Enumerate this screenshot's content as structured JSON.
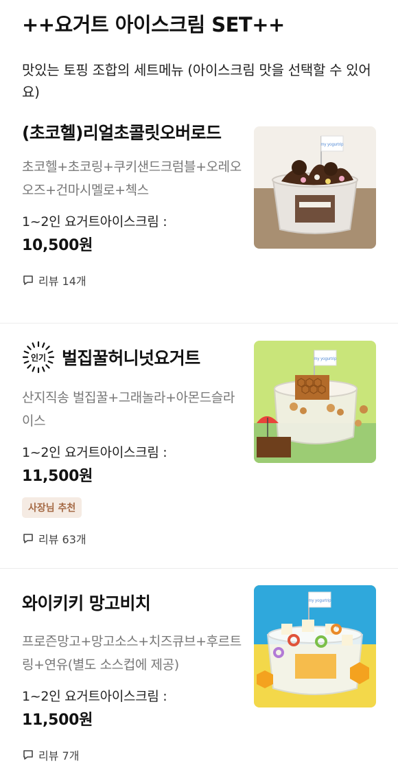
{
  "section": {
    "title": "++요거트 아이스크림 SET++",
    "description": "맛있는 토핑 조합의 세트메뉴 (아이스크림 맛을 선택할 수 있어요)"
  },
  "items": [
    {
      "name": "(초코헬)리얼초콜릿오버로드",
      "description": "초코헬+초코링+쿠키샌드크럼블+오레오오즈+건마시멜로+첵스",
      "serving": "1~2인 요거트아이스크림 :",
      "price": "10,500원",
      "review": "리뷰 14개",
      "image_icon": "chocolate-yogurt-photo"
    },
    {
      "name": "벌집꿀허니넛요거트",
      "popular_label": "인기",
      "description": "산지직송 벌집꿀+그래놀라+아몬드슬라이스",
      "serving": "1~2인 요거트아이스크림 :",
      "price": "11,500원",
      "badge": "사장님 추천",
      "review": "리뷰 63개",
      "image_icon": "honeycomb-yogurt-photo"
    },
    {
      "name": "와이키키 망고비치",
      "description": "프로즌망고+망고소스+치즈큐브+후르트링+연유(별도 소스컵에 제공)",
      "serving": "1~2인 요거트아이스크림 :",
      "price": "11,500원",
      "review": "리뷰 7개",
      "image_icon": "mango-yogurt-photo"
    }
  ],
  "brand_flag_text": "my yogurtrip",
  "colors": {
    "badge_bg": "#f5ebe3",
    "badge_text": "#a56a45",
    "desc_gray": "#777777"
  }
}
